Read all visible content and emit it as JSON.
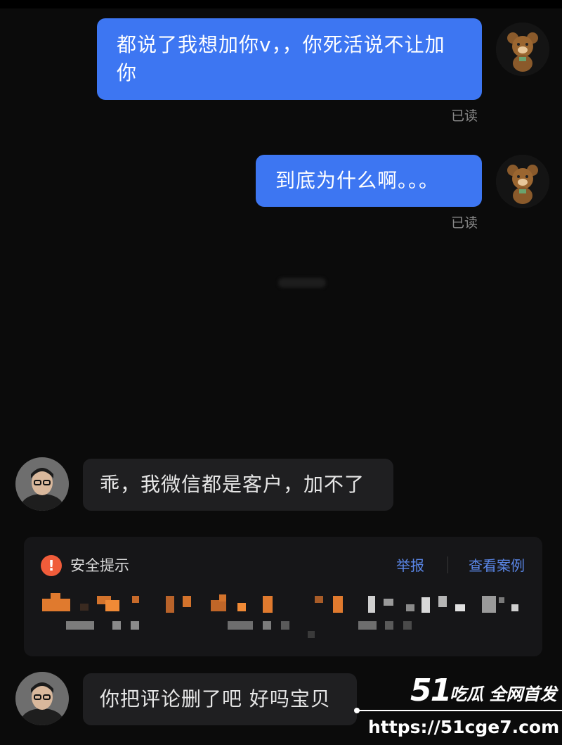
{
  "messages": {
    "out1": {
      "text_line1": "都说了我想加你v，，你死活说不让加",
      "text_line2": "你",
      "status": "已读"
    },
    "out2": {
      "text": "到底为什么啊。。。",
      "status": "已读"
    },
    "in1": {
      "text": "乖，我微信都是客户，加不了"
    },
    "in2": {
      "text": "你把评论删了吧 好吗宝贝"
    }
  },
  "safety": {
    "icon": "!",
    "title": "安全提示",
    "report_label": "举报",
    "cases_label": "查看案例"
  },
  "watermark": {
    "brand_number": "51",
    "brand_text": "吃瓜 全网首发",
    "url": "https://51cge7.com"
  },
  "colors": {
    "accent_blue": "#3d76f2",
    "warning_orange": "#f05c3a",
    "link_blue": "#5a86e6"
  },
  "icons": [
    "bear-avatar",
    "user-avatar",
    "warning-icon"
  ]
}
